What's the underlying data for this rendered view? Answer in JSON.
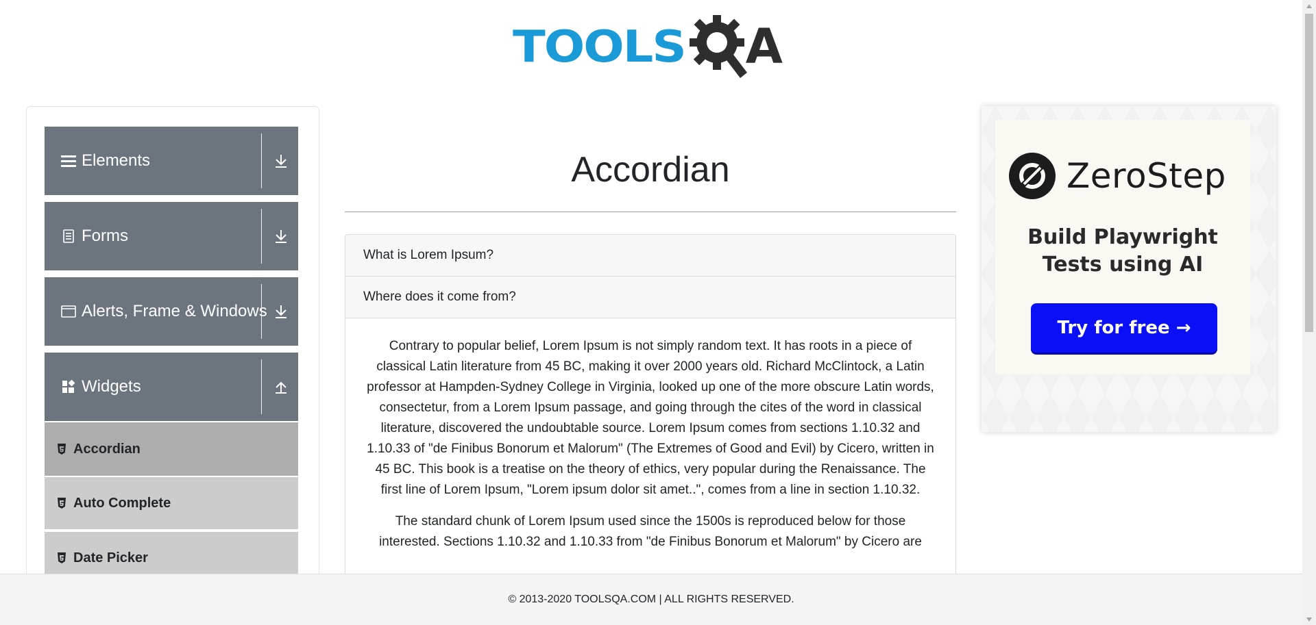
{
  "header": {
    "logo_left": "TOOLS",
    "logo_right": "A",
    "logo_colors": {
      "tools": "#1a9bd7",
      "qa": "#2e2e2e"
    }
  },
  "sidebar": {
    "groups": [
      {
        "label": "Elements",
        "icon": "hamburger-icon",
        "toggle": "download-arrow-icon"
      },
      {
        "label": "Forms",
        "icon": "document-icon",
        "toggle": "download-arrow-icon"
      },
      {
        "label": "Alerts, Frame & Windows",
        "icon": "window-icon",
        "toggle": "download-arrow-icon"
      },
      {
        "label": "Widgets",
        "icon": "widgets-icon",
        "toggle": "upload-arrow-icon",
        "expanded": true
      }
    ],
    "widget_items": [
      {
        "label": "Accordian",
        "active": true,
        "icon": "html5-icon"
      },
      {
        "label": "Auto Complete",
        "active": false,
        "icon": "html5-icon"
      },
      {
        "label": "Date Picker",
        "active": false,
        "icon": "html5-icon"
      }
    ],
    "colors": {
      "group_bg": "#6c757d",
      "item_bg": "#cccccc",
      "item_active_bg": "#adadad"
    }
  },
  "main": {
    "title": "Accordian",
    "sections": [
      {
        "heading": "What is Lorem Ipsum?",
        "expanded": false
      },
      {
        "heading": "Where does it come from?",
        "expanded": true
      }
    ],
    "body_paragraphs": [
      "Contrary to popular belief, Lorem Ipsum is not simply random text. It has roots in a piece of classical Latin literature from 45 BC, making it over 2000 years old. Richard McClintock, a Latin professor at Hampden-Sydney College in Virginia, looked up one of the more obscure Latin words, consectetur, from a Lorem Ipsum passage, and going through the cites of the word in classical literature, discovered the undoubtable source. Lorem Ipsum comes from sections 1.10.32 and 1.10.33 of \"de Finibus Bonorum et Malorum\" (The Extremes of Good and Evil) by Cicero, written in 45 BC. This book is a treatise on the theory of ethics, very popular during the Renaissance. The first line of Lorem Ipsum, \"Lorem ipsum dolor sit amet..\", comes from a line in section 1.10.32.",
      "The standard chunk of Lorem Ipsum used since the 1500s is reproduced below for those interested. Sections 1.10.32 and 1.10.33 from \"de Finibus Bonorum et Malorum\" by Cicero are"
    ]
  },
  "ad": {
    "brand": "ZeroStep",
    "headline_line1": "Build Playwright",
    "headline_line2": "Tests using AI",
    "cta": "Try for free →",
    "colors": {
      "cta_bg": "#0a0ff5",
      "card_bg": "#fbf8f4"
    }
  },
  "footer": {
    "text": "© 2013-2020 TOOLSQA.COM | ALL RIGHTS RESERVED."
  }
}
